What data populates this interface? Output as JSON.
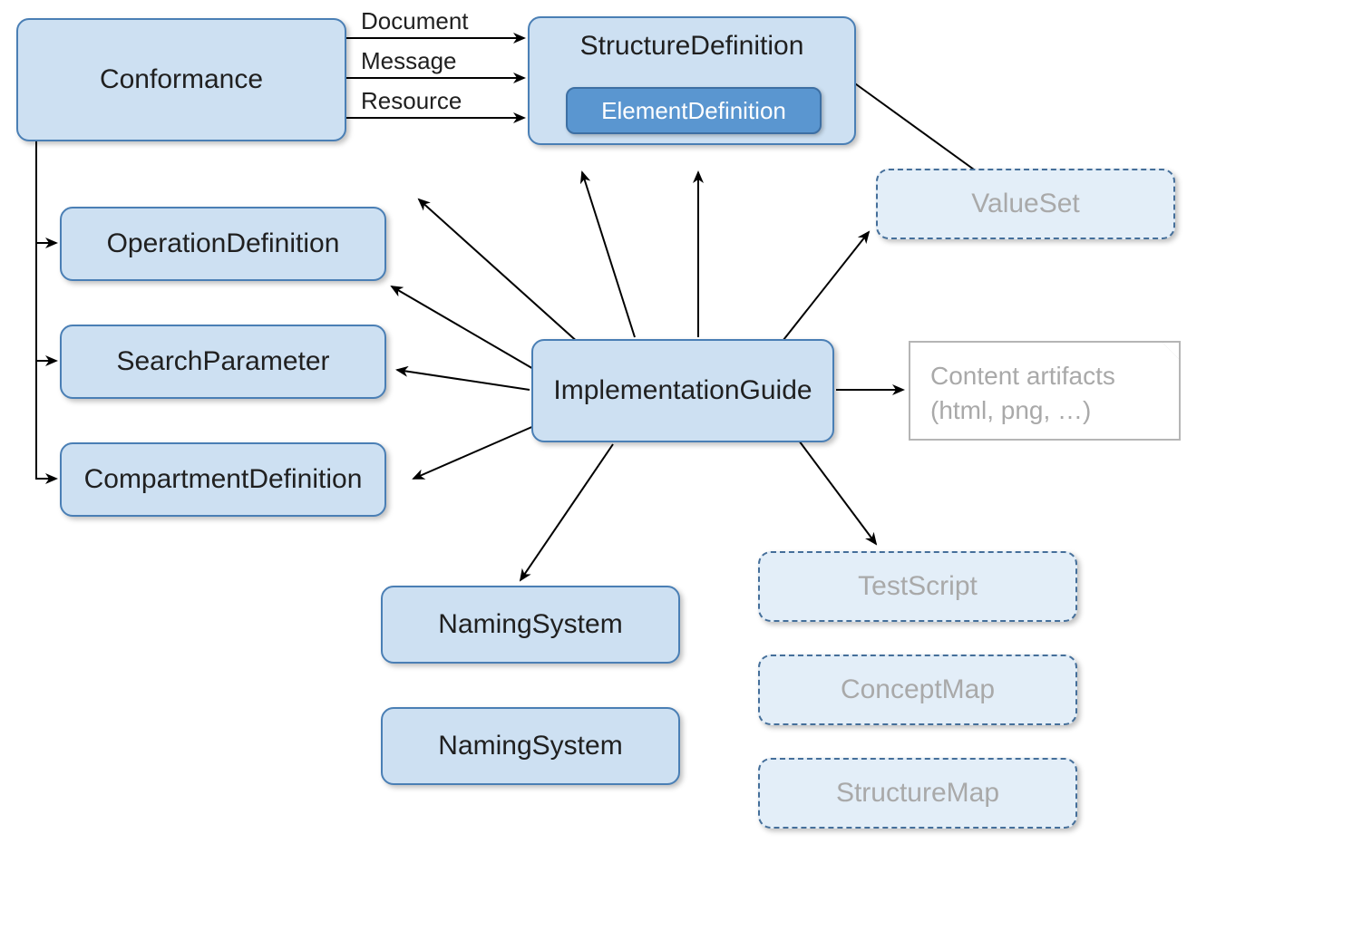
{
  "nodes": {
    "conformance": "Conformance",
    "structureDefinition": "StructureDefinition",
    "elementDefinition": "ElementDefinition",
    "operationDefinition": "OperationDefinition",
    "searchParameter": "SearchParameter",
    "compartmentDefinition": "CompartmentDefinition",
    "implementationGuide": "ImplementationGuide",
    "namingSystem1": "NamingSystem",
    "namingSystem2": "NamingSystem",
    "valueSet": "ValueSet",
    "testScript": "TestScript",
    "conceptMap": "ConceptMap",
    "structureMap": "StructureMap",
    "contentArtifactsLine1": "Content artifacts",
    "contentArtifactsLine2": "(html, png, …)"
  },
  "edgeLabels": {
    "document": "Document",
    "message": "Message",
    "resource": "Resource"
  },
  "colors": {
    "nodeFill": "#cde0f2",
    "nodeBorder": "#4a7fb5",
    "dashedFill": "#e3eef8",
    "dashedText": "#a9a9a9",
    "innerPill": "#5a96d0"
  }
}
